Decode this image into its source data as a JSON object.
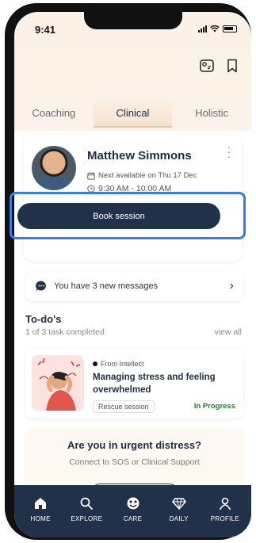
{
  "status_bar": {
    "time": "9:41"
  },
  "tabs": [
    {
      "label": "Coaching",
      "active": false
    },
    {
      "label": "Clinical",
      "active": true
    },
    {
      "label": "Holistic",
      "active": false
    }
  ],
  "coach_card": {
    "name": "Matthew Simmons",
    "availability": "Next available on Thu 17 Dec",
    "time_slot": "9:30 AM - 10:00 AM",
    "book_label": "Book session"
  },
  "messages": {
    "text": "You have 3 new messages"
  },
  "todos": {
    "title": "To-do's",
    "progress": "1 of 3 task completed",
    "view_all": "view all",
    "task": {
      "source": "From Intellect",
      "title": "Managing stress and feeling overwhelmed",
      "tag": "Rescue session",
      "status": "In Progress"
    }
  },
  "distress": {
    "title": "Are you in urgent distress?",
    "subtitle": "Connect to SOS or Clinical Support"
  },
  "bottom_nav": [
    {
      "label": "HOME",
      "icon": "home-icon"
    },
    {
      "label": "EXPLORE",
      "icon": "search-icon"
    },
    {
      "label": "CARE",
      "icon": "care-icon"
    },
    {
      "label": "DAILY",
      "icon": "diamond-icon"
    },
    {
      "label": "PROFILE",
      "icon": "profile-icon"
    }
  ],
  "colors": {
    "accent": "#22314a",
    "highlight": "#3a7de8",
    "status_green": "#2d7a3a"
  }
}
